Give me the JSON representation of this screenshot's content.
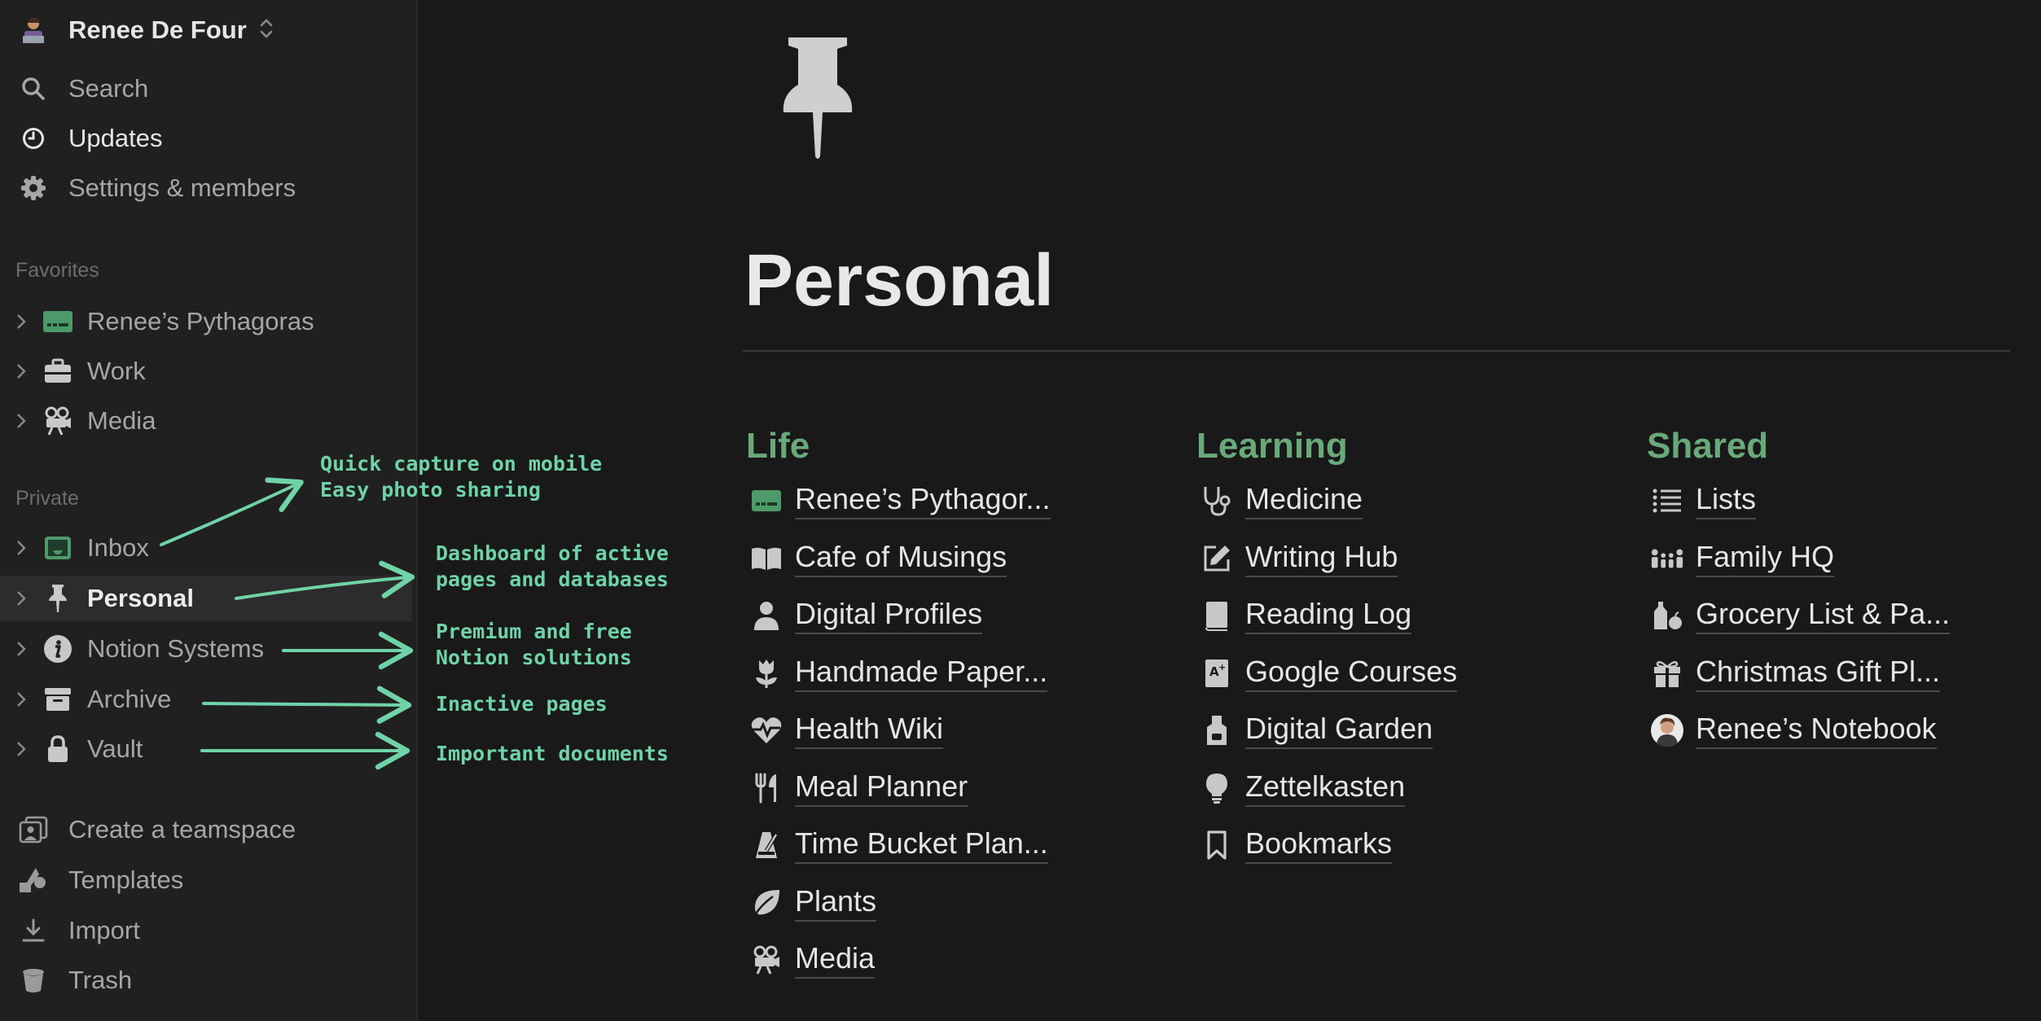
{
  "workspace": {
    "name": "Renee De Four",
    "avatar": "person-at-laptop-emoji"
  },
  "nav": {
    "search": "Search",
    "updates": "Updates",
    "settings": "Settings & members"
  },
  "sidebar": {
    "favorites_label": "Favorites",
    "favorites": [
      {
        "label": "Renee’s Pythagoras",
        "icon": "dashboard-icon"
      },
      {
        "label": "Work",
        "icon": "briefcase-icon"
      },
      {
        "label": "Media",
        "icon": "movie-camera-icon"
      }
    ],
    "private_label": "Private",
    "private": [
      {
        "label": "Inbox",
        "icon": "inbox-icon"
      },
      {
        "label": "Personal",
        "icon": "pushpin-icon"
      },
      {
        "label": "Notion Systems",
        "icon": "info-icon"
      },
      {
        "label": "Archive",
        "icon": "archive-box-icon"
      },
      {
        "label": "Vault",
        "icon": "lock-icon"
      }
    ],
    "bottom": {
      "create_teamspace": "Create a teamspace",
      "templates": "Templates",
      "import": "Import",
      "trash": "Trash"
    }
  },
  "annotations": {
    "inbox": "Quick capture on mobile\nEasy photo sharing",
    "personal": "Dashboard of active\npages and databases",
    "notion_systems": "Premium and free\nNotion solutions",
    "archive": "Inactive pages",
    "vault": "Important documents"
  },
  "page": {
    "icon": "pushpin-icon",
    "title": "Personal",
    "columns": [
      {
        "heading": "Life",
        "links": [
          {
            "label": "Renee’s Pythagor...",
            "icon": "dashboard-icon"
          },
          {
            "label": "Cafe of Musings",
            "icon": "open-book-icon"
          },
          {
            "label": "Digital Profiles",
            "icon": "person-icon"
          },
          {
            "label": "Handmade Paper...",
            "icon": "tulip-icon"
          },
          {
            "label": "Health Wiki",
            "icon": "heart-pulse-icon"
          },
          {
            "label": "Meal Planner",
            "icon": "fork-knife-icon"
          },
          {
            "label": "Time Bucket Plan...",
            "icon": "metronome-icon"
          },
          {
            "label": "Plants",
            "icon": "leaf-icon"
          },
          {
            "label": "Media",
            "icon": "movie-camera-icon"
          }
        ]
      },
      {
        "heading": "Learning",
        "links": [
          {
            "label": "Medicine",
            "icon": "stethoscope-icon"
          },
          {
            "label": "Writing Hub",
            "icon": "edit-icon"
          },
          {
            "label": "Reading Log",
            "icon": "book-icon"
          },
          {
            "label": "Google Courses",
            "icon": "grade-book-icon"
          },
          {
            "label": "Digital Garden",
            "icon": "apron-icon"
          },
          {
            "label": "Zettelkasten",
            "icon": "lightbulb-icon"
          },
          {
            "label": "Bookmarks",
            "icon": "bookmark-icon"
          }
        ]
      },
      {
        "heading": "Shared",
        "links": [
          {
            "label": "Lists",
            "icon": "bullet-list-icon"
          },
          {
            "label": "Family HQ",
            "icon": "family-icon"
          },
          {
            "label": "Grocery List & Pa...",
            "icon": "groceries-icon"
          },
          {
            "label": "Christmas Gift Pl...",
            "icon": "gift-icon"
          },
          {
            "label": "Renee’s Notebook",
            "icon": "avatar-photo-icon"
          }
        ]
      }
    ]
  },
  "colors": {
    "background": "#191919",
    "sidebar": "#202020",
    "accent_green": "#69a97a",
    "annotation": "#6fd3a8"
  }
}
